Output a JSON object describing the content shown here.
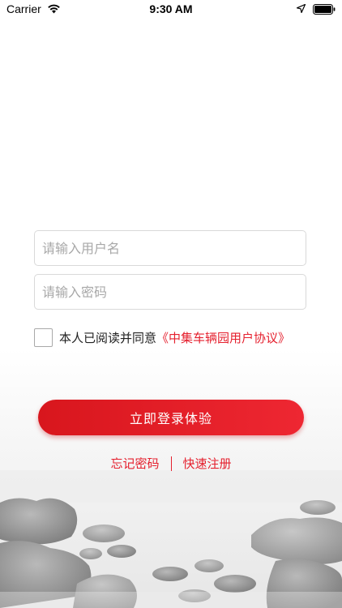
{
  "status_bar": {
    "carrier": "Carrier",
    "time": "9:30 AM"
  },
  "login": {
    "username_placeholder": "请输入用户名",
    "password_placeholder": "请输入密码",
    "agree_text": "本人已阅读并同意",
    "agreement_link": "《中集车辆园用户协议》",
    "agree_checked": false,
    "login_button": "立即登录体验",
    "forgot_password": "忘记密码",
    "quick_register": "快速注册"
  },
  "colors": {
    "accent": "#e5202e",
    "button_start": "#d8161d",
    "button_end": "#ee2732"
  }
}
